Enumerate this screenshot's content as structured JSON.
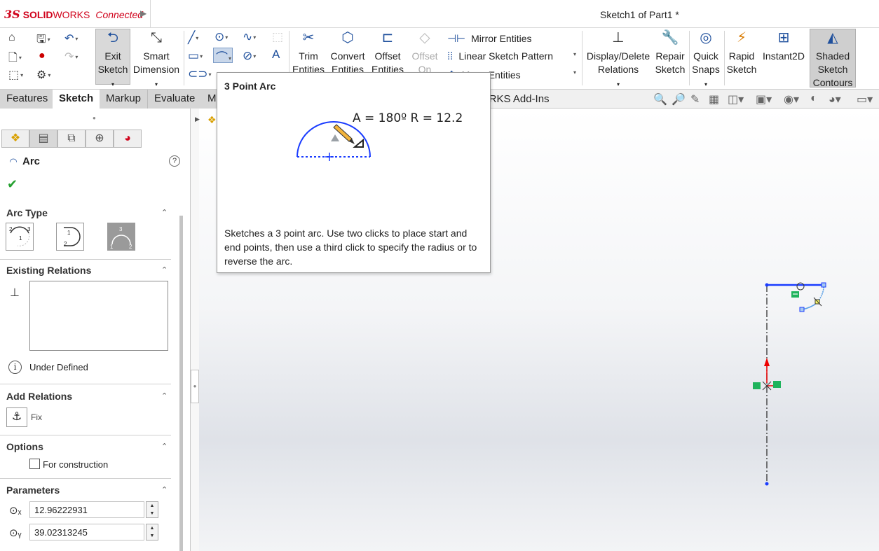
{
  "titlebar": {
    "brand_logo": "3S",
    "brand_bold": "SOLID",
    "brand_regular": "WORKS",
    "brand_suffix": "Connected",
    "document_title": "Sketch1 of Part1 *"
  },
  "ribbon": {
    "exit_sketch": [
      "Exit",
      "Sketch"
    ],
    "smart_dimension": [
      "Smart",
      "Dimension"
    ],
    "trim_entities": [
      "Trim",
      "Entities"
    ],
    "convert_entities": [
      "Convert",
      "Entities"
    ],
    "offset_entities": [
      "Offset",
      "Entities"
    ],
    "offset_on": [
      "Offset",
      "On"
    ],
    "mirror_entities": "Mirror Entities",
    "linear_sketch_pattern": "Linear Sketch Pattern",
    "move_entities": "Move Entities",
    "display_delete_relations": [
      "Display/Delete",
      "Relations"
    ],
    "repair_sketch": [
      "Repair",
      "Sketch"
    ],
    "quick_snaps": [
      "Quick",
      "Snaps"
    ],
    "rapid_sketch": [
      "Rapid",
      "Sketch"
    ],
    "instant2d": "Instant2D",
    "shaded_sketch_contours": [
      "Shaded",
      "Sketch",
      "Contours"
    ]
  },
  "tabs": {
    "features": "Features",
    "sketch": "Sketch",
    "markup": "Markup",
    "evaluate": "Evaluate",
    "partial": "M",
    "addins_partial": "ORKS Add-Ins"
  },
  "panel": {
    "title": "Arc",
    "arc_type": "Arc Type",
    "existing_relations": "Existing Relations",
    "status": "Under Defined",
    "add_relations": "Add Relations",
    "fix": "Fix",
    "options": "Options",
    "for_construction": "For construction",
    "parameters": "Parameters",
    "param_x": "12.96222931",
    "param_y": "39.02313245"
  },
  "tooltip": {
    "title": "3 Point Arc",
    "formula": "A = 180º R = 12.2",
    "description": "Sketches a 3 point arc. Use two clicks to place start and end points, then use a third click to specify the radius or to reverse the arc."
  },
  "colors": {
    "brand_red": "#d0021b",
    "sketch_blue": "#1a3cff",
    "accent_blue": "#1e4f9c",
    "ok_green": "#25a030"
  }
}
